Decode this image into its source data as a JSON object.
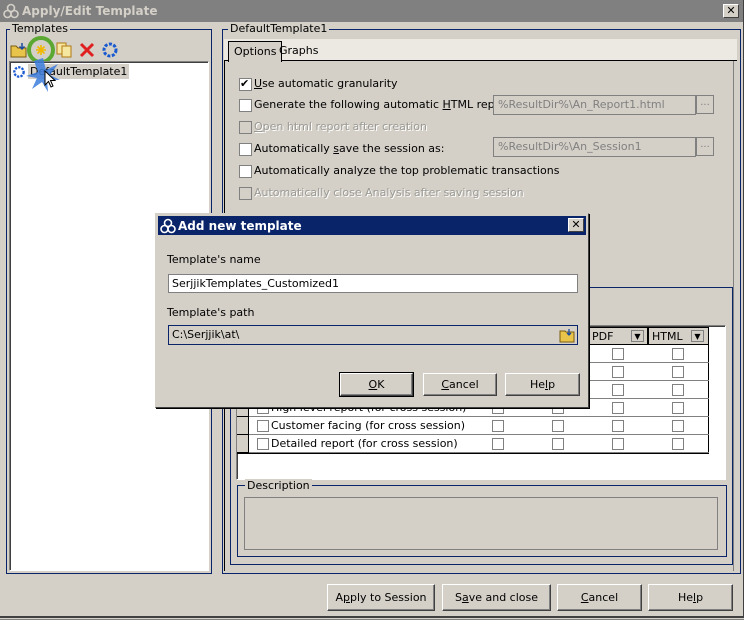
{
  "window": {
    "title": "Apply/Edit Template",
    "close_label": "✕"
  },
  "templates_panel": {
    "group_label": "Templates",
    "toolbar": [
      {
        "name": "import-template-icon",
        "tooltip": ""
      },
      {
        "name": "new-template-icon",
        "tooltip": ""
      },
      {
        "name": "duplicate-template-icon",
        "tooltip": ""
      },
      {
        "name": "delete-template-icon",
        "tooltip": ""
      },
      {
        "name": "apply-template-icon",
        "tooltip": ""
      }
    ],
    "items": [
      {
        "label": "DefaultTemplate1",
        "selected": true
      }
    ]
  },
  "template_panel": {
    "group_label": "DefaultTemplate1",
    "tabs": [
      {
        "label": "Options",
        "active": true
      },
      {
        "label": "Graphs",
        "active": false
      }
    ],
    "options": [
      {
        "label_pre": "",
        "accel": "U",
        "label_post": "se automatic granularity",
        "checked": true,
        "disabled": false
      },
      {
        "label_pre": "Generate the following automatic ",
        "accel": "H",
        "label_post": "TML report",
        "checked": false,
        "disabled": false,
        "field_value": "%ResultDir%\\An_Report1.html"
      },
      {
        "label_pre": "",
        "accel": "O",
        "label_post": "pen html report after creation",
        "checked": false,
        "disabled": true
      },
      {
        "label_pre": "Automatically ",
        "accel": "s",
        "label_post": "ave the session as:",
        "checked": false,
        "disabled": false,
        "field_value": "%ResultDir%\\An_Session1"
      },
      {
        "label_pre": "Automatically analyze the top problematic transactions",
        "accel": "",
        "label_post": "",
        "checked": false,
        "disabled": false
      },
      {
        "label_pre": "Automatically close Analysis after saving session",
        "accel": "",
        "label_post": "",
        "checked": false,
        "disabled": true
      }
    ],
    "ellipsis_label": "...",
    "reports": {
      "columns": [
        "PDF",
        "HTML"
      ],
      "rows": [
        {
          "label": "",
          "pdf": false,
          "html": false
        },
        {
          "label": "",
          "pdf": false,
          "html": false
        },
        {
          "label": "",
          "pdf": false,
          "html": false
        },
        {
          "label": "High level report (for cross session)",
          "pdf": false,
          "html": false
        },
        {
          "label": "Customer facing (for cross session)",
          "pdf": false,
          "html": false
        },
        {
          "label": "Detailed report (for cross session)",
          "pdf": false,
          "html": false
        }
      ]
    },
    "description": {
      "group_label": "Description",
      "value": ""
    }
  },
  "footer_buttons": [
    {
      "pre": "A",
      "accel": "p",
      "post": "ply to Session"
    },
    {
      "pre": "S",
      "accel": "a",
      "post": "ve and close"
    },
    {
      "pre": "",
      "accel": "C",
      "post": "ancel"
    },
    {
      "pre": "He",
      "accel": "l",
      "post": "p"
    }
  ],
  "dialog": {
    "title": "Add new template",
    "close_label": "✕",
    "name_label": "Template's name",
    "name_value": "SerjjikTemplates_Customized1",
    "path_label": "Template's path",
    "path_value": "C:\\Serjjik\\at\\",
    "buttons": [
      {
        "pre": "",
        "accel": "O",
        "post": "K",
        "default": true
      },
      {
        "pre": "",
        "accel": "C",
        "post": "ancel",
        "default": false
      },
      {
        "pre": "He",
        "accel": "l",
        "post": "p",
        "default": false
      }
    ]
  },
  "colors": {
    "active_title": "#0a246a",
    "inactive_title": "#808080",
    "face": "#d4d0c8",
    "highlight_ring": "#4caf2a",
    "cursor_burst": "#3b7ddd"
  }
}
